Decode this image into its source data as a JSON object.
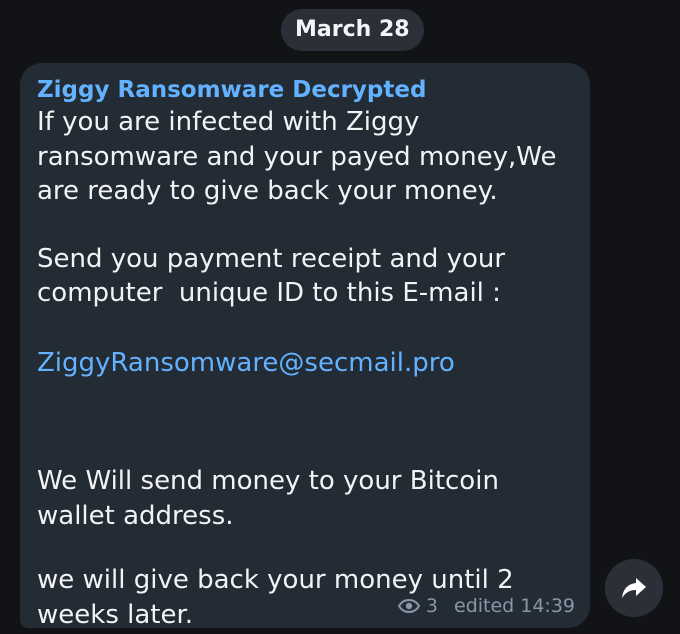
{
  "date_separator": "March 28",
  "message": {
    "sender_name": "Ziggy Ransomware Decrypted",
    "lines": {
      "l1": "If you are infected with Ziggy",
      "l2": "ransomware and your payed money,We",
      "l3": "are ready to give back your money.",
      "l4": "Send you payment receipt and your",
      "l5": "computer  unique ID to this E-mail :",
      "email": "ZiggyRansomware@secmail.pro",
      "l6": "We Will send money to your Bitcoin",
      "l7": "wallet address.",
      "l8": "we will give back your money until 2",
      "l9": "weeks later."
    },
    "views": "3",
    "edited_label": "edited",
    "time": "14:39"
  },
  "icons": {
    "views": "eye-icon",
    "share": "share-icon"
  },
  "colors": {
    "background": "#111316",
    "bubble": "#232b35",
    "accent": "#63b2ff",
    "text": "#f1f3f5",
    "meta": "#8a97a8"
  }
}
